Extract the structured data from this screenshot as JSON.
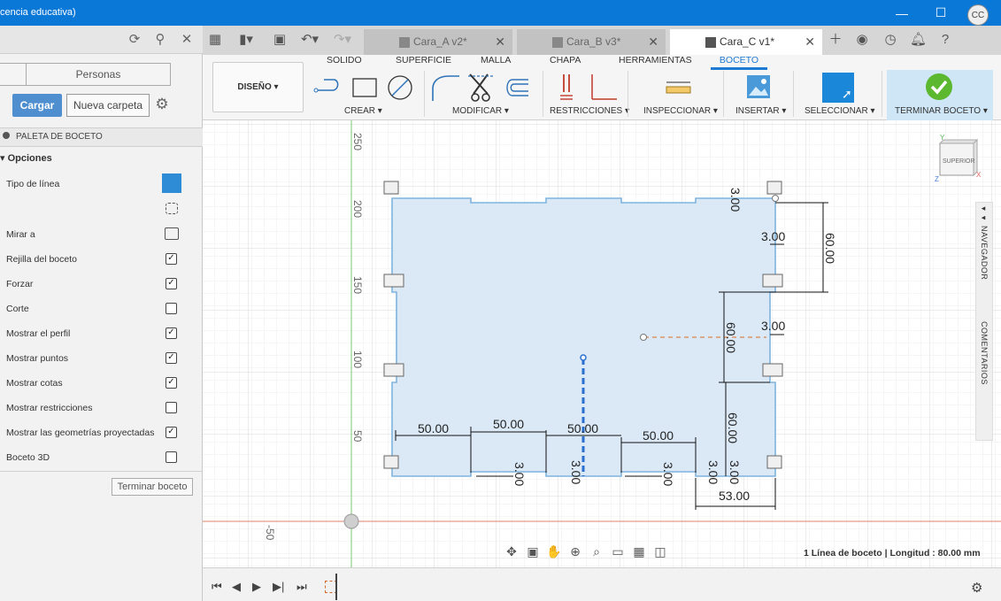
{
  "window": {
    "title": "cencia educativa)",
    "minimize": "—",
    "maximize": "☐",
    "close": "✕"
  },
  "data_panel": {
    "segment_left": "",
    "segment_right": "Personas",
    "upload_label": "Cargar",
    "new_folder_label": "Nueva carpeta"
  },
  "sketch_palette": {
    "header": "PALETA DE BOCETO",
    "options_header": "▾ Opciones",
    "rows": [
      {
        "label": "Tipo de línea",
        "checked": null
      },
      {
        "label": "Mirar a",
        "checked": null
      },
      {
        "label": "Rejilla del boceto",
        "checked": true
      },
      {
        "label": "Forzar",
        "checked": true
      },
      {
        "label": "Corte",
        "checked": false
      },
      {
        "label": "Mostrar el perfil",
        "checked": true
      },
      {
        "label": "Mostrar puntos",
        "checked": true
      },
      {
        "label": "Mostrar cotas",
        "checked": true
      },
      {
        "label": "Mostrar restricciones",
        "checked": false
      },
      {
        "label": "Mostrar las geometrías proyectadas",
        "checked": true
      },
      {
        "label": "Boceto 3D",
        "checked": false
      }
    ],
    "finish_label": "Terminar boceto"
  },
  "tabs": [
    {
      "label": "Cara_A v2*",
      "active": false
    },
    {
      "label": "Cara_B v3*",
      "active": false
    },
    {
      "label": "Cara_C v1*",
      "active": true
    }
  ],
  "avatar": "CC",
  "ribbon": {
    "tabs": [
      "SOLIDO",
      "SUPERFICIE",
      "MALLA",
      "CHAPA",
      "HERRAMIENTAS",
      "BOCETO"
    ],
    "active_tab": "BOCETO",
    "workspace": "DISEÑO ▾",
    "groups": [
      "CREAR ▾",
      "MODIFICAR ▾",
      "RESTRICCIONES ▾",
      "INSPECCIONAR ▾",
      "INSERTAR ▾",
      "SELECCIONAR ▾",
      "TERMINAR BOCETO ▾"
    ]
  },
  "canvas": {
    "ruler_labels": [
      "250",
      "200",
      "150",
      "100",
      "50",
      "-50"
    ],
    "dimensions": [
      "50.00",
      "50.00",
      "50.00",
      "50.00",
      "53.00",
      "60.00",
      "60.00",
      "60.00",
      "3.00",
      "3.00",
      "3.00",
      "3.00",
      "3.00",
      "3.00",
      "3.00",
      "3.00"
    ],
    "viewcube_label": "SUPERIOR",
    "axis_labels": [
      "Y",
      "X",
      "Z"
    ]
  },
  "side_panels": {
    "navigator": "◂◂ NAVEGADOR",
    "comments": "COMENTARIOS"
  },
  "status": "1 Línea de boceto | Longitud : 80.00 mm",
  "colors": {
    "titlebar": "#0a78d7",
    "accent": "#1f7ad1",
    "sketch_fill": "#dbe9f6",
    "sketch_line": "#7fb3de"
  }
}
